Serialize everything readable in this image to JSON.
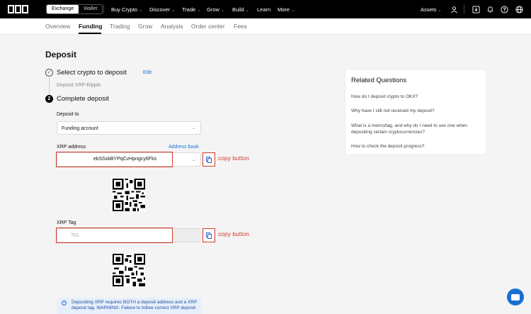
{
  "header": {
    "segments": [
      "Exchange",
      "Wallet"
    ],
    "nav": [
      "Buy Crypto",
      "Discover",
      "Trade",
      "Grow",
      "Build",
      "Learn",
      "More"
    ],
    "nav_has_caret": [
      true,
      true,
      true,
      true,
      true,
      false,
      true
    ],
    "assets_label": "Assets",
    "icons": [
      "user-icon",
      "download-icon",
      "bell-icon",
      "help-icon",
      "globe-icon"
    ]
  },
  "subnav": {
    "tabs": [
      "Overview",
      "Funding",
      "Trading",
      "Grow",
      "Analysis",
      "Order center",
      "Fees"
    ],
    "active": "Funding"
  },
  "page": {
    "title": "Deposit",
    "step1": {
      "label": "Select crypto to deposit",
      "edit": "Edit",
      "selected": "Deposit XRP-Ripple"
    },
    "step2": {
      "number": "2",
      "label": "Complete deposit"
    }
  },
  "form": {
    "deposit_to_label": "Deposit to",
    "deposit_to_value": "Funding account",
    "address_label": "XRP address",
    "address_book": "Address book",
    "address_value": "ekSSxkBYPqCvHpngcy6Fks",
    "tag_label": "XRP Tag",
    "tag_value": "?01",
    "annotation_copy_1": "copy button",
    "annotation_copy_2": "copy button",
    "notice": "Depositing XRP requires BOTH a deposit address and a XRP deposit tag. WARNING: Failure to follow correct XRP deposit"
  },
  "related": {
    "title": "Related Questions",
    "items": [
      "How do I deposit crypto to OKX?",
      "Why have I still not received my deposit?",
      "What is a memo/tag, and why do I need to use one when depositing certain cryptocurrencies?",
      "How to check the deposit progress?"
    ]
  },
  "colors": {
    "accent": "#1a6fd3",
    "annotation": "#d13a2a",
    "nav_bg": "#000000"
  }
}
